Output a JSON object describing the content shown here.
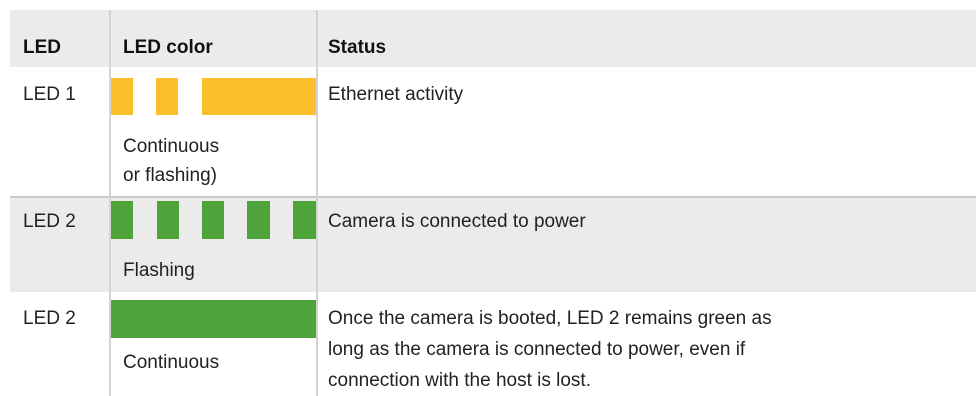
{
  "headers": {
    "led": "LED",
    "color": "LED color",
    "status": "Status"
  },
  "rows": [
    {
      "led": "LED 1",
      "color_note_lines": [
        "Continuous",
        "or flashing)"
      ],
      "status_lines": [
        "Ethernet activity"
      ],
      "indicator_color": "#fbbf2e",
      "indicator_pattern": "flashing"
    },
    {
      "led": "LED 2",
      "color_note_lines": [
        "Flashing"
      ],
      "status_lines": [
        "Camera is connected to power"
      ],
      "indicator_color": "#4ea43a",
      "indicator_pattern": "flashing"
    },
    {
      "led": "LED 2",
      "color_note_lines": [
        "Continuous"
      ],
      "status_lines": [
        "Once the camera is booted, LED 2 remains green as",
        "long as the camera is connected to power, even if",
        "connection with the host is lost."
      ],
      "indicator_color": "#4ea43a",
      "indicator_pattern": "continuous"
    }
  ],
  "colors": {
    "header_bg": "#ebebeb",
    "amber": "#fbbf2e",
    "green": "#4ea43a"
  }
}
